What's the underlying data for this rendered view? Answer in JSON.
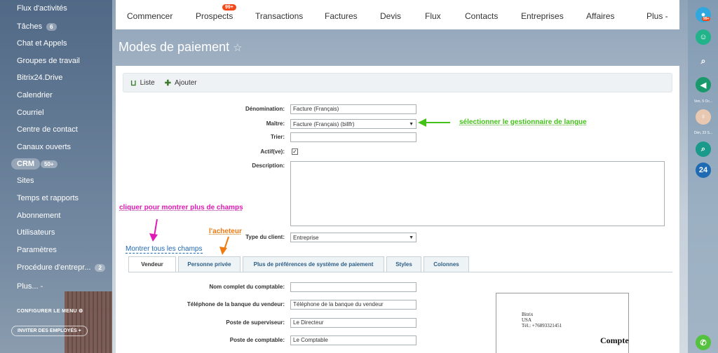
{
  "sidebar": {
    "items": [
      {
        "label": "Flux d'activités"
      },
      {
        "label": "Tâches",
        "count": "6"
      },
      {
        "label": "Chat et Appels"
      },
      {
        "label": "Groupes de travail"
      },
      {
        "label": "Bitrix24.Drive"
      },
      {
        "label": "Calendrier"
      },
      {
        "label": "Courriel"
      },
      {
        "label": "Centre de contact"
      },
      {
        "label": "Canaux ouverts"
      },
      {
        "label": "CRM",
        "count": "50+"
      },
      {
        "label": "Sites"
      },
      {
        "label": "Temps et rapports"
      },
      {
        "label": "Abonnement"
      },
      {
        "label": "Utilisateurs"
      },
      {
        "label": "Paramètres"
      },
      {
        "label": "Procédure d'entrepr...",
        "count": "2"
      },
      {
        "label": "Plus... -"
      }
    ],
    "configure_menu": "CONFIGURER LE MENU",
    "invite": "INVITER DES EMPLOYÉS"
  },
  "topnav": {
    "items": [
      "Commencer",
      "Prospects",
      "Transactions",
      "Factures",
      "Devis",
      "Flux",
      "Contacts",
      "Entreprises",
      "Affaires",
      "Plus -"
    ],
    "prospects_badge": "99+"
  },
  "page": {
    "title": "Modes de paiement",
    "star": "☆"
  },
  "toolbar": {
    "list_label": "Liste",
    "add_label": "Ajouter"
  },
  "form": {
    "denomination_label": "Dénomination:",
    "denomination_value": "Facture (Français)",
    "maitre_label": "Maître:",
    "maitre_value": "Facture (Français) (billfr)",
    "trier_label": "Trier:",
    "trier_value": "",
    "actif_label": "Actif(ve):",
    "actif_checked": true,
    "description_label": "Description:",
    "client_type_label": "Type du client:",
    "client_type_value": "Entreprise"
  },
  "annotations": {
    "langue": "sélectionner le gestionnaire de langue",
    "champs": "cliquer pour montrer plus de champs",
    "acheteur": "l'acheteur",
    "colors": {
      "green": "#44c21a",
      "magenta": "#e01bb5",
      "orange": "#f07a10"
    }
  },
  "show_all_fields": "Montrer tous les champs",
  "tabs": [
    "Vendeur",
    "Personne privée",
    "Plus de préférences de système de paiement",
    "Styles",
    "Colonnes"
  ],
  "vendor_fields": [
    {
      "label": "Nom complet du comptable:",
      "value": ""
    },
    {
      "label": "Téléphone de la banque du vendeur:",
      "value": "Téléphone de la banque du vendeur"
    },
    {
      "label": "Poste de superviseur:",
      "value": "Le Directeur"
    },
    {
      "label": "Poste de comptable:",
      "value": "Le Comptable"
    }
  ],
  "invoice_preview": {
    "lines": [
      "Bitrix",
      "USA",
      "Tél.: +76893321451"
    ],
    "title": "Compte"
  },
  "rightbar": {
    "badge": "99+",
    "date1": "Ven, 5 Oc...",
    "date2": "Dim, 23 S...",
    "b24": "24"
  }
}
